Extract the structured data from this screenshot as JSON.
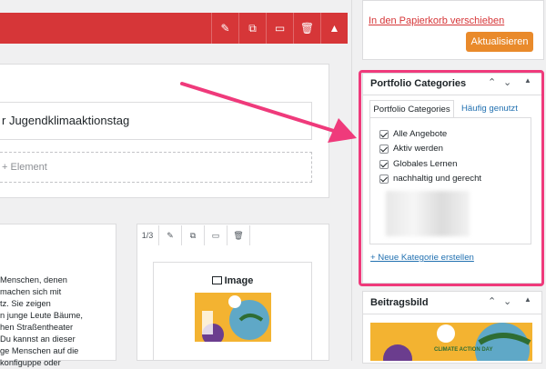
{
  "editor": {
    "toolbar_icons": [
      "pencil-icon",
      "duplicate-icon",
      "layout-icon",
      "trash-icon",
      "arrow-up-icon"
    ],
    "row_title": "r Jugendklimaaktionstag",
    "add_element": "+ Element",
    "column_text_lines": [
      "Menschen, denen",
      " machen sich mit",
      "tz. Sie zeigen",
      "n junge Leute Bäume,",
      "hen Straßentheater",
      "Du kannst an dieser",
      "ge Menschen auf die",
      "konfiguppe oder"
    ],
    "column_toolbar": {
      "fraction": "1/3",
      "icons": [
        "pencil-icon",
        "duplicate-icon",
        "layout-icon",
        "trash-icon"
      ]
    },
    "image_title": "Image",
    "image_icon": "image-icon"
  },
  "publish": {
    "trash_link": "In den Papierkorb verschieben",
    "update_button": "Aktualisieren"
  },
  "categories_panel": {
    "title": "Portfolio Categories",
    "tabs": [
      "Portfolio Categories",
      "Häufig genutzt"
    ],
    "items": [
      {
        "label": "Alle Angebote",
        "checked": true
      },
      {
        "label": "Aktiv werden",
        "checked": true
      },
      {
        "label": "Globales Lernen",
        "checked": true
      },
      {
        "label": "nachhaltig und gerecht",
        "checked": true
      }
    ],
    "new_category_link": "+ Neue Kategorie erstellen"
  },
  "featured_image_panel": {
    "title": "Beitragsbild",
    "image_caption": "CLIMATE ACTION DAY"
  },
  "colors": {
    "editor_red": "#d63638",
    "update_orange": "#e98a2b",
    "highlight_pink": "#ef3a7b",
    "link_blue": "#2271b1",
    "thumb_yellow": "#f3b331"
  }
}
